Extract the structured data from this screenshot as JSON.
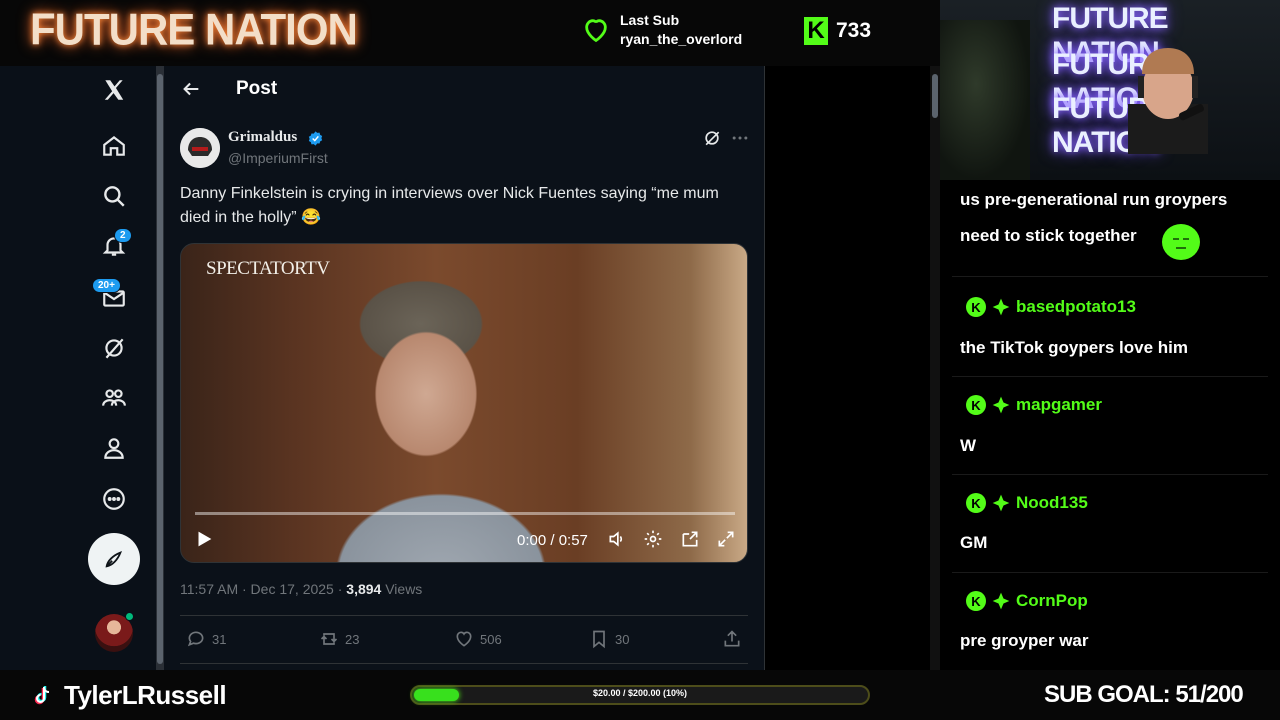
{
  "overlay": {
    "brand": "FUTURE NATION",
    "last_sub_label": "Last Sub",
    "last_sub_user": "ryan_the_overlord",
    "kick_count": "733",
    "kick_logo": "K",
    "streamer_name": "TylerLRussell",
    "goal_text": "$20.00 / $200.00 (10%)",
    "goal_fraction": 0.1,
    "sub_goal": "SUB GOAL: 51/200",
    "cam_signs": [
      "FUTURE NATION",
      "FUTURE NATION",
      "FUTURE NATION"
    ],
    "accent": "#53fc18"
  },
  "x_app": {
    "nav": {
      "notifications_badge": "2",
      "messages_badge": "20+",
      "icons": [
        "x-logo-icon",
        "home-icon",
        "search-icon",
        "bell-icon",
        "mail-icon",
        "grok-icon",
        "communities-icon",
        "profile-icon",
        "more-icon",
        "compose-icon"
      ]
    },
    "header": {
      "title": "Post"
    },
    "tweet": {
      "author_name": "Grimaldus",
      "author_handle": "@ImperiumFirst",
      "text": "Danny Finkelstein is crying in interviews over Nick Fuentes saying “me mum died in the holly” 😂",
      "video_logo": "SPECTATORTV",
      "video_time": "0:00 / 0:57",
      "time": "11:57 AM · Dec 17, 2025 · ",
      "views_count": "3,894",
      "views_label": " Views",
      "replies": "31",
      "reposts": "23",
      "likes": "506",
      "bookmarks": "30"
    },
    "accent": "#1d9bf0"
  },
  "chat": {
    "messages": [
      {
        "user": "",
        "text_line1": "us pre-generational run groypers",
        "text_line2": "need to stick together"
      },
      {
        "user": "basedpotato13",
        "text": "the TikTok goypers love him"
      },
      {
        "user": "mapgamer",
        "text": "W"
      },
      {
        "user": "Nood135",
        "text": "GM"
      },
      {
        "user": "CornPop",
        "text": "pre groyper war"
      }
    ]
  }
}
